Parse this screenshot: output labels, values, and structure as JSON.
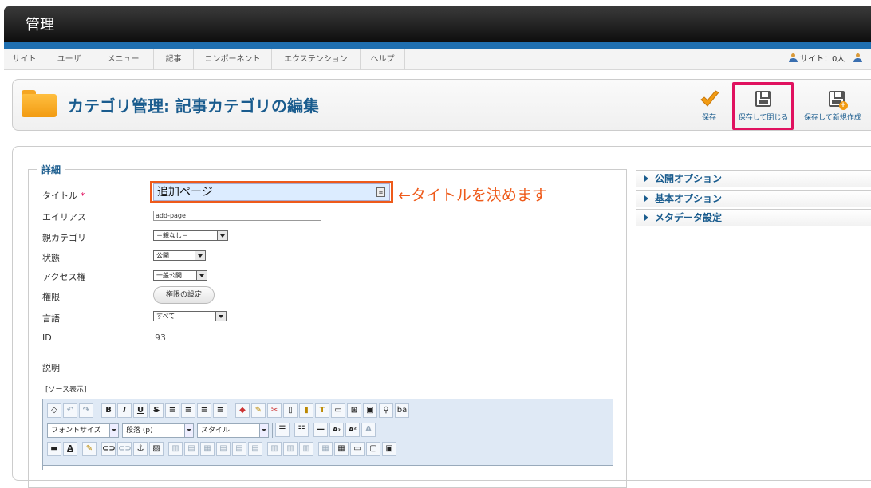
{
  "header": {
    "title": "管理"
  },
  "menu": {
    "items": [
      "サイト",
      "ユーザ",
      "メニュー",
      "記事",
      "コンポーネント",
      "エクステンション",
      "ヘルプ"
    ],
    "site_status": "サイト：0人"
  },
  "page": {
    "title": "カテゴリ管理: 記事カテゴリの編集"
  },
  "toolbar": {
    "save": "保存",
    "save_close": "保存して閉じる",
    "save_new": "保存して新規作成"
  },
  "form": {
    "legend": "詳細",
    "labels": {
      "title": "タイトル",
      "required": "*",
      "alias": "エイリアス",
      "parent": "親カテゴリ",
      "state": "状態",
      "access": "アクセス権",
      "permissions": "権限",
      "language": "言語",
      "id": "ID",
      "description": "説明"
    },
    "title_value": "追加ページ",
    "alias_value": "add-page",
    "parent_value": "－親なし－",
    "state_value": "公開",
    "access_value": "一般公開",
    "permissions_button": "権限の設定",
    "language_value": "すべて",
    "id_value": "93",
    "source_toggle": "[ソース表示]",
    "annotation": "←タイトルを決めます"
  },
  "editor": {
    "font_family": "フォントサイズ",
    "format": "段落 (p)",
    "style": "スタイル"
  },
  "sidebar": {
    "panels": [
      "公開オプション",
      "基本オプション",
      "メタデータ設定"
    ]
  }
}
